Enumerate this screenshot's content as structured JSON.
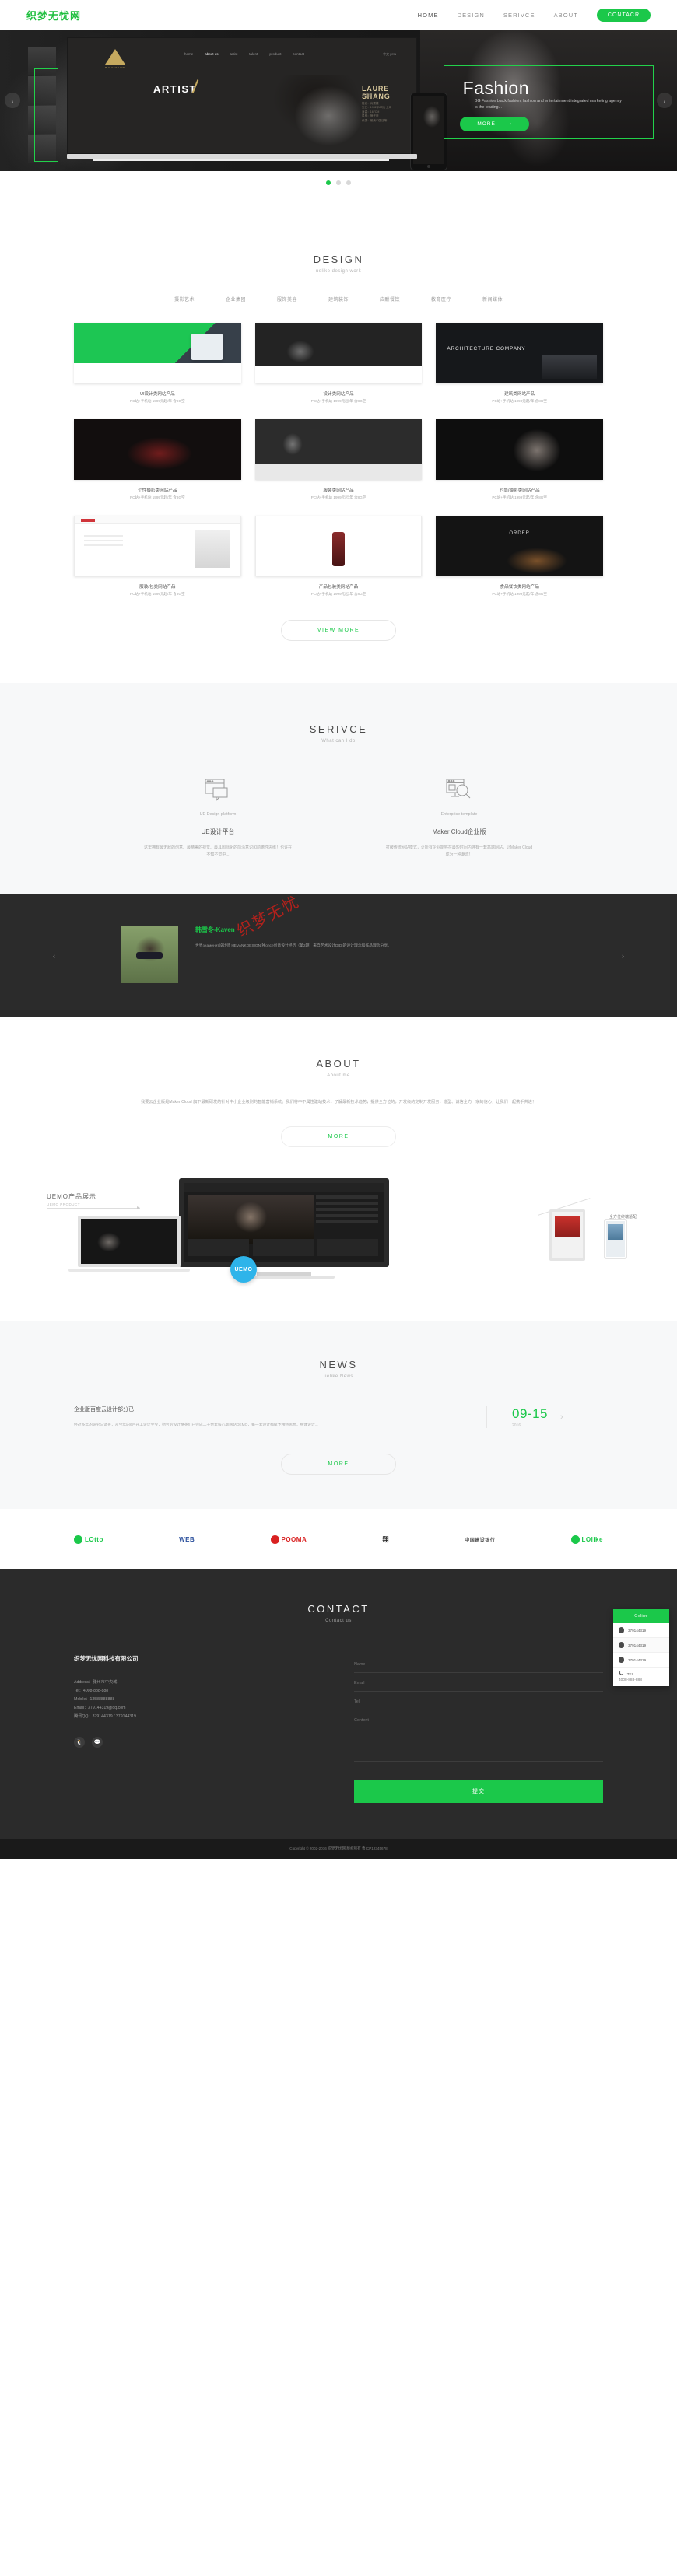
{
  "header": {
    "logo": "织梦无忧网",
    "nav": [
      {
        "label": "HOME"
      },
      {
        "label": "DESIGN"
      },
      {
        "label": "SERIVCE"
      },
      {
        "label": "ABOUT"
      }
    ],
    "cta": "CONTACR"
  },
  "hero": {
    "inner_nav": [
      "home",
      "about us",
      "artist",
      "talent",
      "product",
      "contact"
    ],
    "inner_lang": "中文 | EN",
    "brand_sub": "B.G FASHION",
    "artist_word": "ARTIST",
    "model_name": "LAURE SHANG",
    "model_name_cn": "尚雯婕",
    "model_meta": [
      "姓名：尚雯婕",
      "生日：1982年8月 | 上海",
      "身高：167CM",
      "星座：狮子座",
      "代表：最美中国话等"
    ],
    "title": "Fashion",
    "desc": "BG Fashion black fashion, fashion and entertainment integrated marketing agency is the leading...",
    "more": "MORE",
    "arrow_prev": "‹",
    "arrow_next": "›",
    "dots": 3,
    "active_dot": 0
  },
  "design": {
    "title": "DESIGN",
    "subtitle": "uelike design work",
    "filters": [
      "摄影艺术",
      "企业集团",
      "服饰美容",
      "建筑装饰",
      "应酬餐饮",
      "教育医疗",
      "新闻媒体"
    ],
    "price_note": "PC站+手机站 1999元起/年 含8G空",
    "cards": [
      {
        "title": "UI设计类网站产品",
        "note": "PC站+手机站 1999元起/年 含8G空",
        "style": "green"
      },
      {
        "title": "设计类网站产品",
        "note": "PC站+手机站 1999元起/年 含8G空",
        "style": "darkui"
      },
      {
        "title": "建筑类网站产品",
        "note": "PC站+手机站 1999元起/年 含8G空",
        "style": "arch",
        "label": "ARCHITECTURE COMPANY"
      },
      {
        "title": "个性摄影类网站产品",
        "note": "PC站+手机站 1999元起/年 含8G空",
        "style": "red"
      },
      {
        "title": "服装类网站产品",
        "note": "PC站+手机站 1999元起/年 含8G空",
        "style": "grey"
      },
      {
        "title": "时尚/摄影类网站产品",
        "note": "PC站+手机站 1999元起/年 含8G空",
        "style": "face"
      },
      {
        "title": "服装/包类网站产品",
        "note": "PC站+手机站 1999元起/年 含8G空",
        "style": "white"
      },
      {
        "title": "产品包装类网站产品",
        "note": "PC站+手机站 1999元起/年 含8G空",
        "style": "bottle"
      },
      {
        "title": "食品餐饮类网站产品",
        "note": "PC站+手机站 1999元起/年 含8G空",
        "style": "food",
        "label": "ORDER"
      }
    ],
    "view_more": "VIEW MORE"
  },
  "service": {
    "title": "SERIVCE",
    "subtitle": "What can I do",
    "items": [
      {
        "en": "UE Design platform",
        "cn": "UE设计平台",
        "text": "这里拥有最无敌的创意、最精美的视觉、最具国际化的前沿意识和前瞻性思维！也许在不知不觉中..."
      },
      {
        "en": "Enterprise template",
        "cn": "Maker Cloud企业版",
        "text": "打破传统网站模式，让所有企业能够在最短时间内拥有一套高端网站，让Maker Cloud成为一种潮流！"
      }
    ]
  },
  "testimonial": {
    "name": "韩雪冬-Kaven",
    "text": "世界знаменит设计师 HEVANKDESIGN 独once创意设计经历（第2期）来自艺术设计DIDI的设计理念和作品理念分享。",
    "watermark": "织梦无忧",
    "arrow_prev": "‹",
    "arrow_next": "›"
  },
  "about": {
    "title": "ABOUT",
    "subtitle": "About me",
    "text": "我要云企业版是Maker Cloud 旗下最新研发的针对中小企业级别的智能营销系统。我们将中不属性建站技术，了解最新技术趋势，提供全方位的，开发级的定制开发服务，造型、诚信全力一家的信心，让我们一起携手共进！",
    "more": "MORE"
  },
  "showcase": {
    "label": "UEMO产品展示",
    "label_sub": "UEMO PRODUCT",
    "label_right": "全方位终端适配",
    "label_right_sub": "Supports",
    "badge": "UEMO"
  },
  "news": {
    "title": "NEWS",
    "subtitle": "uelike News",
    "items": [
      {
        "title": "企业版百度云设计部分已",
        "desc": "经过多年的研究与调查，从今年的6月开工设计至今，勤劳的设计精英们已完成二十余套核心版网站DEMO，每一套设计都赋予独特思想，整体设计...",
        "date": "09-15",
        "year": "2016"
      }
    ],
    "more": "MORE"
  },
  "partners": [
    {
      "name": "LOtto",
      "color": "#1bc84a"
    },
    {
      "name": "WEB",
      "color": "#2a4f9c"
    },
    {
      "name": "POOMA",
      "color": "#d92121"
    },
    {
      "name": "翔",
      "color": "#222222"
    },
    {
      "name": "中国建设银行",
      "color": "#444444"
    },
    {
      "name": "LOlike",
      "color": "#1bc84a"
    }
  ],
  "contact": {
    "title": "CONTACT",
    "subtitle": "Contact us",
    "company": "织梦无忧网科技有限公司",
    "lines": [
      "Address：滕州市中央城",
      "Tel：4008-888-888",
      "Mobile：13588888888",
      "Email：379144319@qq.com",
      "腾讯QQ：379144319 / 379144319"
    ],
    "social": [
      "qq-icon",
      "wechat-icon"
    ],
    "form": {
      "name_placeholder": "Name",
      "email_placeholder": "Email",
      "tel_placeholder": "Tel",
      "content_placeholder": "Content",
      "submit": "提交"
    }
  },
  "copyright": "Copyright © 2002-2016 织梦无忧网 版权所有 鲁ICP12345678",
  "qq_panel": {
    "head": "Online",
    "items": [
      "379144319",
      "379144319",
      "379144319"
    ],
    "tel_label": "TEL",
    "tel_number": "4008-888-888"
  }
}
